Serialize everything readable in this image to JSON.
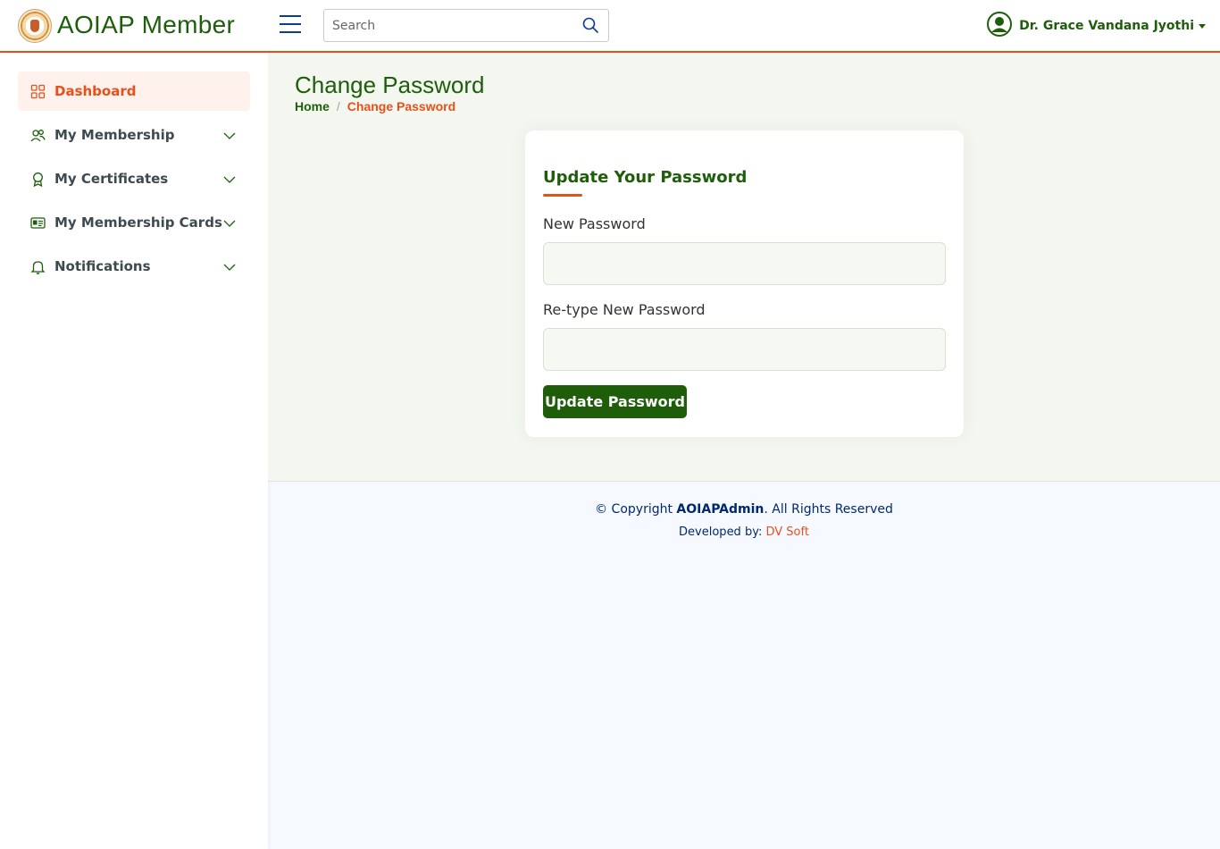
{
  "app": {
    "brand": "AOIAP Member"
  },
  "header": {
    "search_placeholder": "Search",
    "user_name": "Dr. Grace Vandana Jyothi"
  },
  "sidebar": {
    "items": [
      {
        "label": "Dashboard",
        "icon": "grid-icon",
        "active": true
      },
      {
        "label": "My Membership",
        "icon": "people-icon"
      },
      {
        "label": "My Certificates",
        "icon": "award-icon"
      },
      {
        "label": "My Membership Cards",
        "icon": "id-card-icon"
      },
      {
        "label": "Notifications",
        "icon": "bell-icon"
      }
    ]
  },
  "page": {
    "title": "Change Password",
    "breadcrumb": {
      "home": "Home",
      "separator": "/",
      "current": "Change Password"
    }
  },
  "card": {
    "title": "Update Your Password",
    "new_password_label": "New Password",
    "retype_password_label": "Re-type New Password",
    "submit_label": "Update Password"
  },
  "footer": {
    "copyright_prefix": "© Copyright ",
    "copyright_brand": "AOIAPAdmin",
    "copyright_suffix": ". All Rights Reserved",
    "developed_by": "Developed by: ",
    "developer": "DV Soft"
  },
  "colors": {
    "brand_green": "#1e5e0b",
    "accent_orange": "#e8501a",
    "navy": "#012970"
  }
}
